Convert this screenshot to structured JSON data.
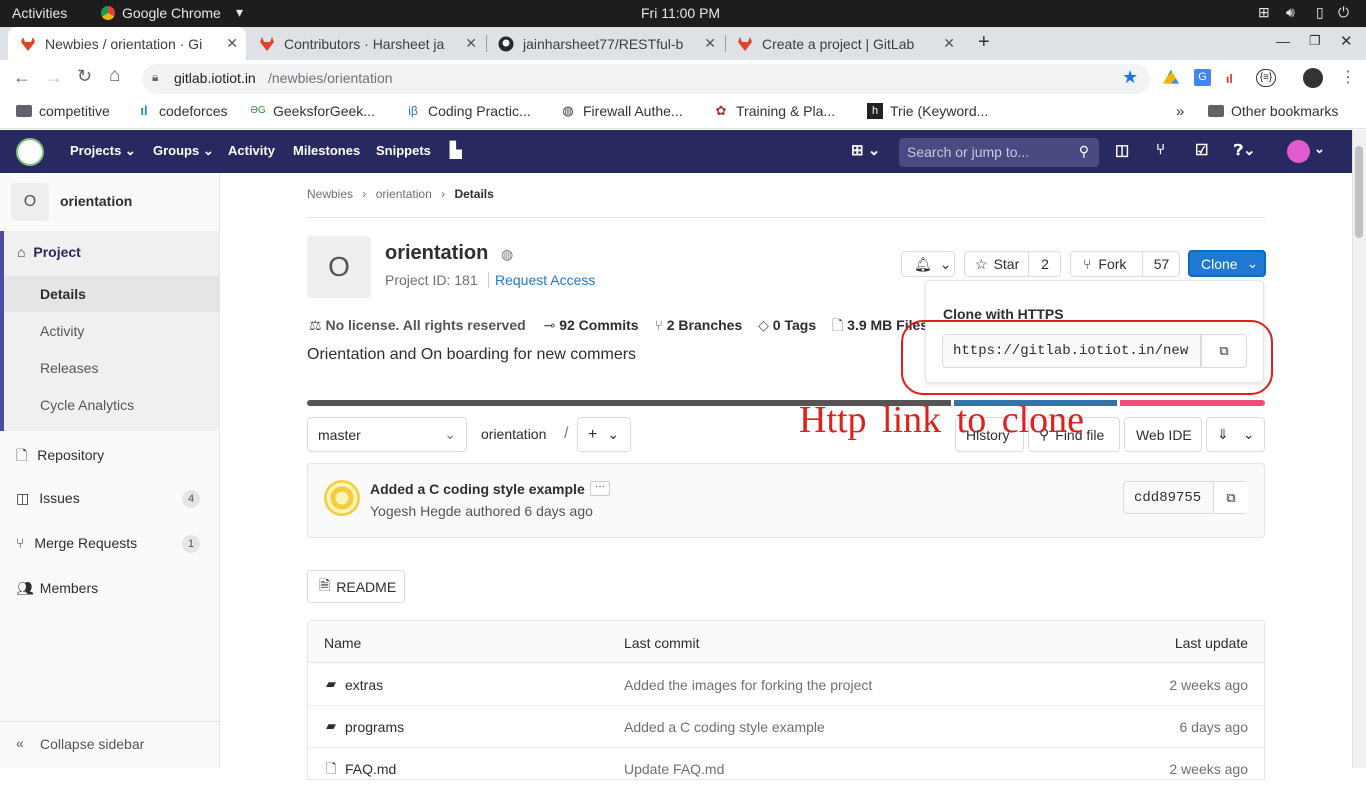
{
  "os": {
    "activities": "Activities",
    "app": "Google Chrome",
    "clock": "Fri 11:00 PM"
  },
  "tabs": [
    {
      "title": "Newbies / orientation · Gi",
      "active": true
    },
    {
      "title": "Contributors · Harsheet ja",
      "active": false
    },
    {
      "title": "jainharsheet77/RESTful-b",
      "active": false
    },
    {
      "title": "Create a project | GitLab",
      "active": false
    }
  ],
  "address": {
    "domain": "gitlab.iotiot.in",
    "path": "/newbies/orientation"
  },
  "bookmarks": [
    "competitive",
    "codeforces",
    "GeeksforGeek...",
    "Coding Practic...",
    "Firewall Authe...",
    "Training & Pla...",
    "Trie (Keyword...",
    "Other bookmarks"
  ],
  "nav": {
    "projects": "Projects",
    "groups": "Groups",
    "activity": "Activity",
    "milestones": "Milestones",
    "snippets": "Snippets",
    "search_placeholder": "Search or jump to..."
  },
  "sidebar": {
    "project_letter": "O",
    "project_name": "orientation",
    "project_header": "Project",
    "sub": [
      "Details",
      "Activity",
      "Releases",
      "Cycle Analytics"
    ],
    "repository": "Repository",
    "issues": "Issues",
    "issues_count": "4",
    "merge_requests": "Merge Requests",
    "mr_count": "1",
    "members": "Members",
    "collapse": "Collapse sidebar"
  },
  "breadcrumb": [
    "Newbies",
    "orientation",
    "Details"
  ],
  "project": {
    "letter": "O",
    "name": "orientation",
    "id_text": "Project ID: 181",
    "request_access": "Request Access",
    "license": "No license. All rights reserved",
    "commits": "92 Commits",
    "branches": "2 Branches",
    "tags": "0 Tags",
    "size": "3.9 MB Files",
    "description": "Orientation and On boarding for new commers"
  },
  "actions": {
    "star": "Star",
    "star_count": "2",
    "fork": "Fork",
    "fork_count": "57",
    "clone": "Clone"
  },
  "clone_popup": {
    "title": "Clone with HTTPS",
    "url": "https://gitlab.iotiot.in/new"
  },
  "annotation": "Http  link  to  clone",
  "repo_bar": {
    "branch": "master",
    "path": "orientation",
    "history": "History",
    "find_file": "Find file",
    "web_ide": "Web IDE"
  },
  "last_commit": {
    "message": "Added a C coding style example",
    "author": "Yogesh Hegde authored 6 days ago",
    "sha": "cdd89755"
  },
  "readme_button": "README",
  "table": {
    "headers": [
      "Name",
      "Last commit",
      "Last update"
    ],
    "rows": [
      {
        "name": "extras",
        "commit": "Added the images for forking the project",
        "updated": "2 weeks ago"
      },
      {
        "name": "programs",
        "commit": "Added a C coding style example",
        "updated": "6 days ago"
      },
      {
        "name": "FAQ.md",
        "commit": "Update FAQ.md",
        "updated": "2 weeks ago"
      }
    ]
  },
  "colors": {
    "nav": "#292961",
    "accent": "#1f78d1",
    "annotation": "#e0201b"
  }
}
